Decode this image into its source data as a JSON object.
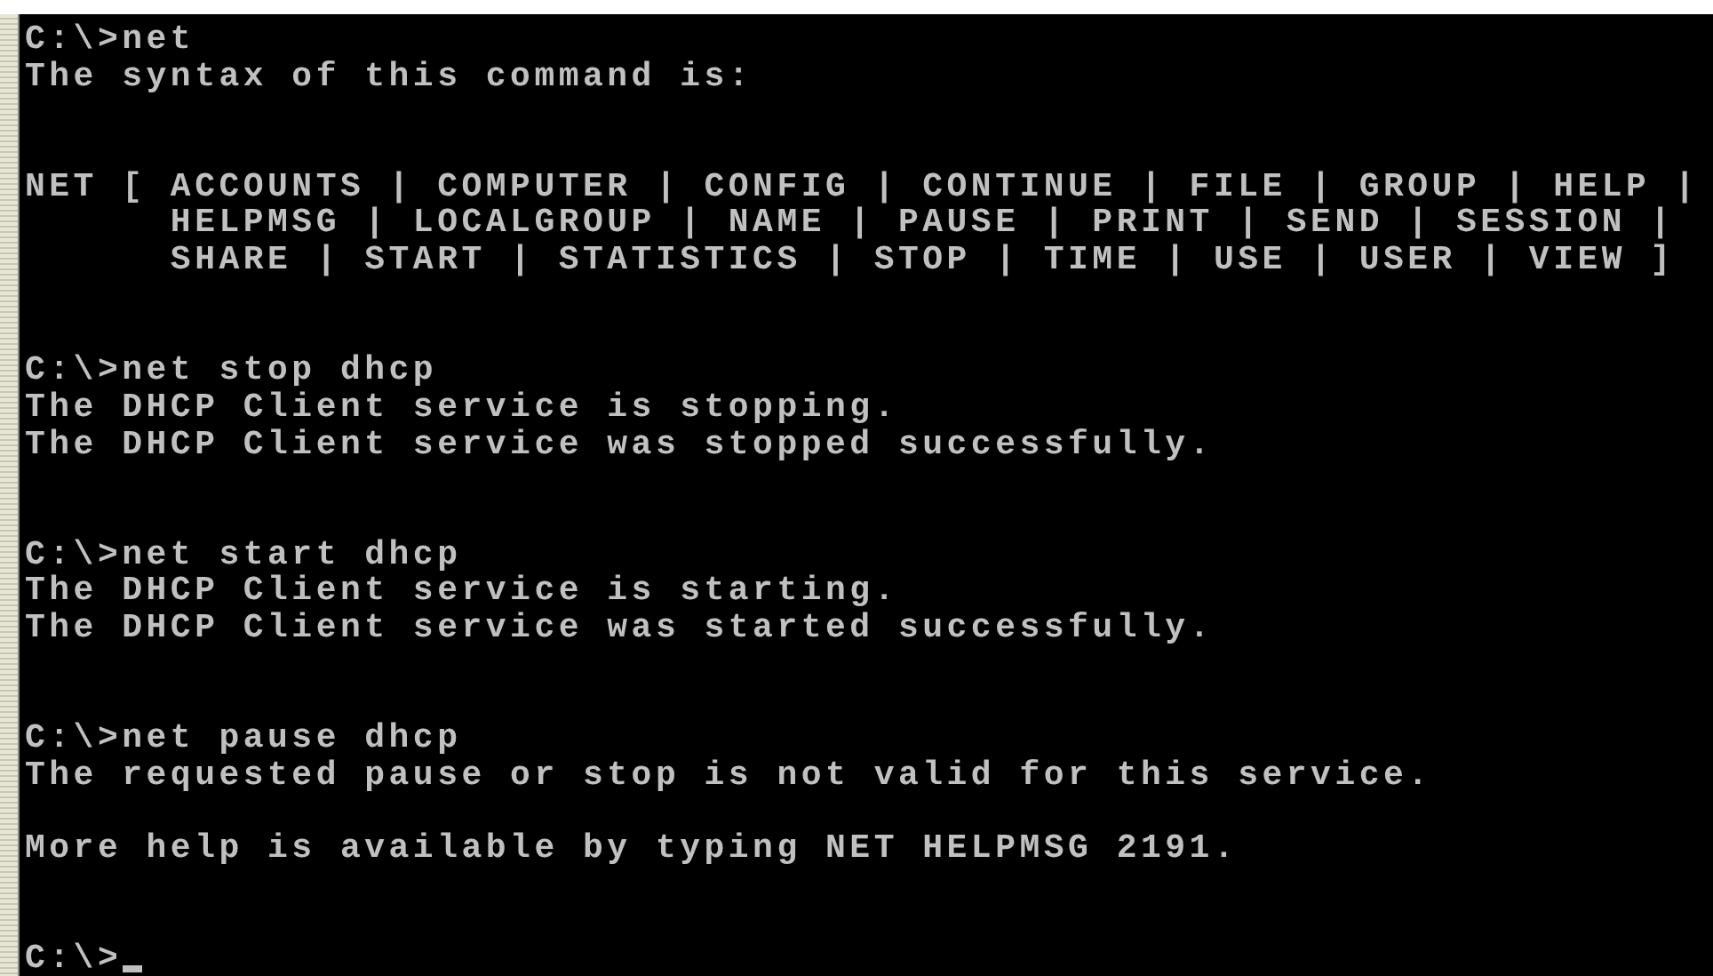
{
  "console": {
    "blocks": [
      {
        "kind": "output",
        "lines": [
          "C:\\>net",
          "The syntax of this command is:"
        ]
      },
      {
        "kind": "output",
        "lines": [
          "NET [ ACCOUNTS | COMPUTER | CONFIG | CONTINUE | FILE | GROUP | HELP |",
          "      HELPMSG | LOCALGROUP | NAME | PAUSE | PRINT | SEND | SESSION |",
          "      SHARE | START | STATISTICS | STOP | TIME | USE | USER | VIEW ]"
        ]
      },
      {
        "kind": "output",
        "lines": [
          "C:\\>net stop dhcp",
          "The DHCP Client service is stopping.",
          "The DHCP Client service was stopped successfully."
        ]
      },
      {
        "kind": "output",
        "lines": [
          "C:\\>net start dhcp",
          "The DHCP Client service is starting.",
          "The DHCP Client service was started successfully."
        ]
      },
      {
        "kind": "output",
        "lines": [
          "C:\\>net pause dhcp",
          "The requested pause or stop is not valid for this service."
        ]
      },
      {
        "kind": "note",
        "lines": [
          "More help is available by typing NET HELPMSG 2191."
        ]
      },
      {
        "kind": "prompt",
        "lines": [
          "C:\\>"
        ]
      }
    ]
  }
}
